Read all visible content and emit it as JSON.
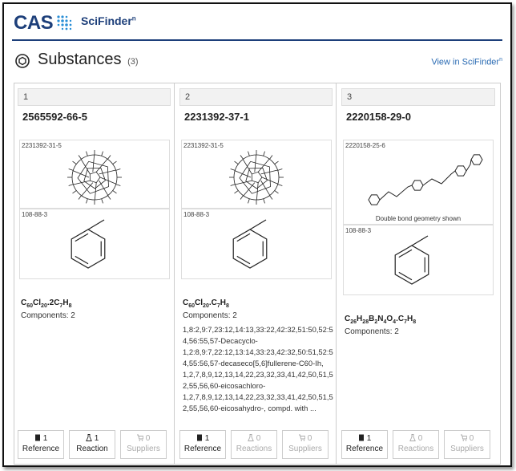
{
  "header": {
    "logo": "CAS",
    "product": "SciFinder",
    "product_sup": "n"
  },
  "title": {
    "label": "Substances",
    "count": "(3)",
    "link": "View in SciFinder",
    "link_sup": "n"
  },
  "cards": [
    {
      "index": "1",
      "cas_rn": "2565592-66-5",
      "structures": [
        {
          "label": "2231392-31-5",
          "kind": "fullerene",
          "note": ""
        },
        {
          "label": "108-88-3",
          "kind": "toluene",
          "note": ""
        }
      ],
      "formula": "C60Cl20.2C7H8",
      "components": "Components: 2",
      "description": "",
      "actions": [
        {
          "icon": "book-icon",
          "count": "1",
          "label": "Reference",
          "enabled": true
        },
        {
          "icon": "flask-icon",
          "count": "1",
          "label": "Reaction",
          "enabled": true
        },
        {
          "icon": "cart-icon",
          "count": "0",
          "label": "Suppliers",
          "enabled": false
        }
      ]
    },
    {
      "index": "2",
      "cas_rn": "2231392-37-1",
      "structures": [
        {
          "label": "2231392-31-5",
          "kind": "fullerene",
          "note": ""
        },
        {
          "label": "108-88-3",
          "kind": "toluene",
          "note": ""
        }
      ],
      "formula": "C60Cl20.C7H8",
      "components": "Components: 2",
      "description": "1,8:2,9:7,23:12,14:13,33:22,42:32,51:50,52:54,56:55,57-Decacyclo-1,2:8,9:7,22:12,13:14,33:23,42:32,50:51,52:54,55:56,57-decaseco[5,6]fullerene-C60-Ih, 1,2,7,8,9,12,13,14,22,23,32,33,41,42,50,51,52,55,56,60-eicosachloro-1,2,7,8,9,12,13,14,22,23,32,33,41,42,50,51,52,55,56,60-eicosahydro-, compd. with ...",
      "actions": [
        {
          "icon": "book-icon",
          "count": "1",
          "label": "Reference",
          "enabled": true
        },
        {
          "icon": "flask-icon",
          "count": "0",
          "label": "Reactions",
          "enabled": false
        },
        {
          "icon": "cart-icon",
          "count": "0",
          "label": "Suppliers",
          "enabled": false
        }
      ]
    },
    {
      "index": "3",
      "cas_rn": "2220158-29-0",
      "structures": [
        {
          "label": "2220158-25-6",
          "kind": "chain",
          "note": "Double bond geometry shown"
        },
        {
          "label": "108-88-3",
          "kind": "toluene",
          "note": ""
        }
      ],
      "formula": "C26H28B2N4O4.C7H8",
      "components": "Components: 2",
      "description": "",
      "actions": [
        {
          "icon": "book-icon",
          "count": "1",
          "label": "Reference",
          "enabled": true
        },
        {
          "icon": "flask-icon",
          "count": "0",
          "label": "Reactions",
          "enabled": false
        },
        {
          "icon": "cart-icon",
          "count": "0",
          "label": "Suppliers",
          "enabled": false
        }
      ]
    }
  ]
}
